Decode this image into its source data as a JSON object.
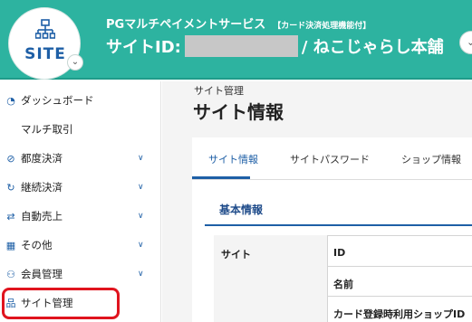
{
  "header": {
    "logo_text": "SITE",
    "service_title": "PGマルチペイメントサービス",
    "service_tag": "【カード決済処理機能付】",
    "site_id_label": "サイトID:",
    "site_name": "/ ねこじゃらし本舗"
  },
  "sidebar": {
    "items": [
      {
        "label": "ダッシュボード",
        "icon": "dashboard-icon",
        "chevron": false
      },
      {
        "label": "マルチ取引",
        "icon": "",
        "chevron": false
      },
      {
        "label": "都度決済",
        "icon": "check-circle-icon",
        "chevron": true
      },
      {
        "label": "継続決済",
        "icon": "refresh-icon",
        "chevron": true
      },
      {
        "label": "自動売上",
        "icon": "sync-arrows-icon",
        "chevron": true
      },
      {
        "label": "その他",
        "icon": "grid-icon",
        "chevron": true
      },
      {
        "label": "会員管理",
        "icon": "users-icon",
        "chevron": true
      },
      {
        "label": "サイト管理",
        "icon": "sitemap-icon",
        "chevron": false
      }
    ],
    "active": "サイト管理"
  },
  "main": {
    "breadcrumb": "サイト管理",
    "title": "サイト情報",
    "tabs": [
      {
        "label": "サイト情報",
        "active": true
      },
      {
        "label": "サイトパスワード",
        "active": false
      },
      {
        "label": "ショップ情報",
        "active": false
      }
    ],
    "section_title": "基本情報",
    "table": {
      "group_label": "サイト",
      "rows": [
        {
          "label": "ID"
        },
        {
          "label": "名前"
        },
        {
          "label": "カード登録時利用ショップID"
        }
      ]
    }
  },
  "colors": {
    "header_bg": "#2db3a0",
    "accent_blue": "#1e5fa6",
    "highlight_red": "#e0141e"
  }
}
